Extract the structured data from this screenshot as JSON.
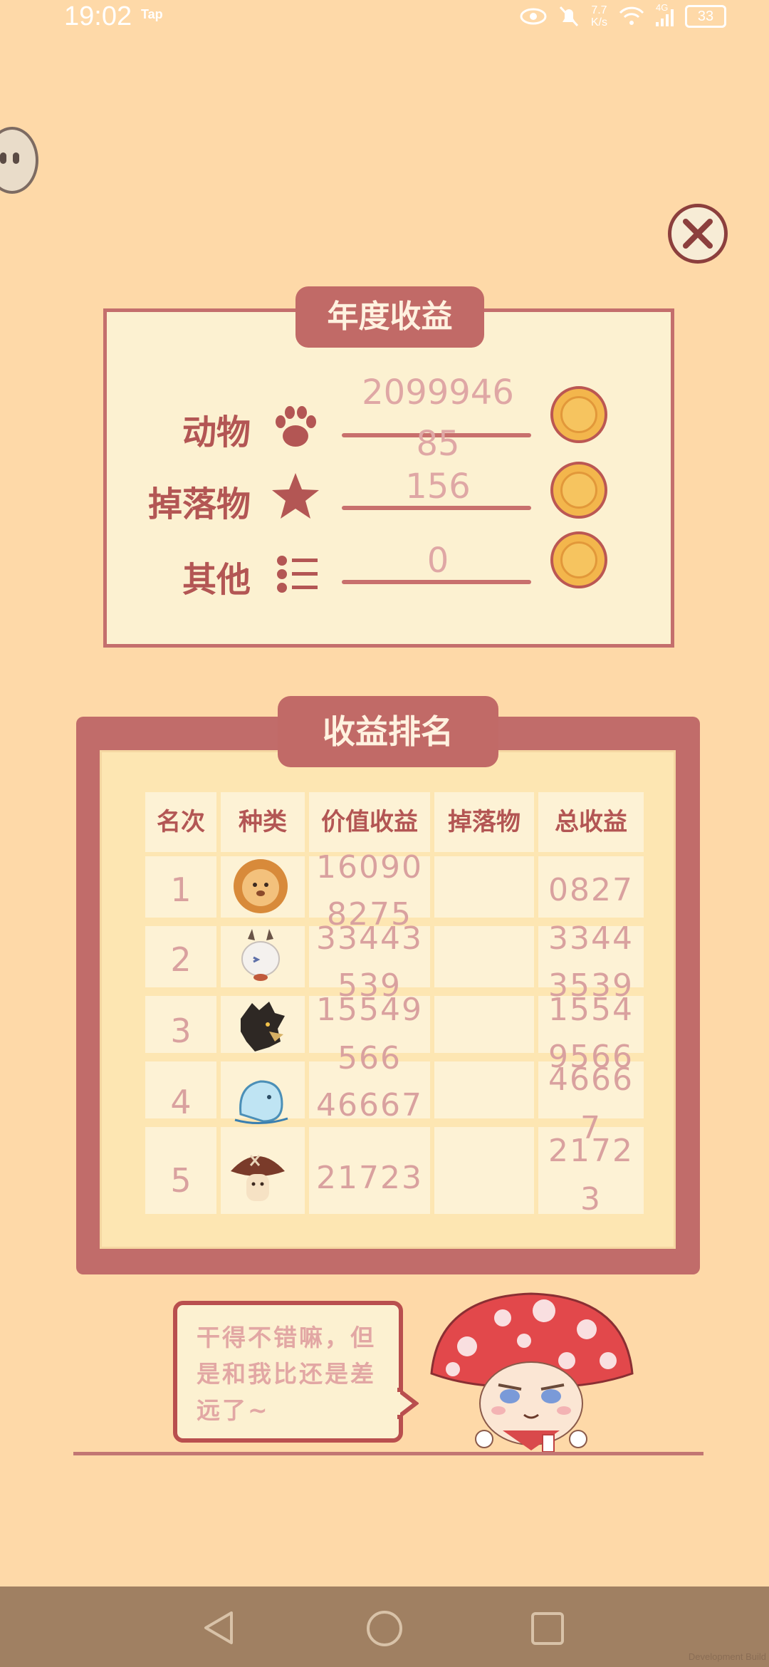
{
  "status_bar": {
    "time": "19:02",
    "tap_label": "Tap",
    "net_speed_top": "7.7",
    "net_speed_bottom": "K/s",
    "signal_label": "4G",
    "battery": "33"
  },
  "annual_income": {
    "title": "年度收益",
    "rows": [
      {
        "label": "动物",
        "icon": "paw-icon",
        "value_line1": "2099946",
        "value_line2": "85"
      },
      {
        "label": "掉落物",
        "icon": "star-icon",
        "value_line1": "156",
        "value_line2": ""
      },
      {
        "label": "其他",
        "icon": "list-icon",
        "value_line1": "0",
        "value_line2": ""
      }
    ],
    "coin_icon": "mushroom-coin-icon"
  },
  "ranking": {
    "title": "收益排名",
    "headers": [
      "名次",
      "种类",
      "价值收益",
      "掉落物",
      "总收益"
    ],
    "rows": [
      {
        "rank": "1",
        "animal": "lion-icon",
        "value": "16090",
        "drops": "",
        "total": "0827"
      },
      {
        "rank": "2",
        "animal": "goat-icon",
        "value": "33443",
        "drops": "",
        "total": "3344"
      },
      {
        "rank": "3",
        "animal": "eagle-icon",
        "value": "15549",
        "drops": "",
        "total": "1554"
      },
      {
        "rank": "4",
        "animal": "whale-icon",
        "value": "46667",
        "drops": "",
        "total": "4666"
      },
      {
        "rank": "5",
        "animal": "mushroom-icon",
        "value": "21723",
        "drops": "",
        "total": "2172"
      }
    ],
    "overflow_values": [
      "8275",
      "539",
      "566"
    ],
    "overflow_totals": [
      "3539",
      "9566",
      "7",
      "3"
    ]
  },
  "dialog": {
    "text_line1": "干得不错嘛，但",
    "text_line2": "是和我比还是差",
    "text_line3": "远了~"
  },
  "watermark": "Development Build",
  "colors": {
    "background": "#fed9a8",
    "accent": "#c16a67",
    "panel": "#fcf1d1",
    "value_text": "#dfa7a5"
  }
}
